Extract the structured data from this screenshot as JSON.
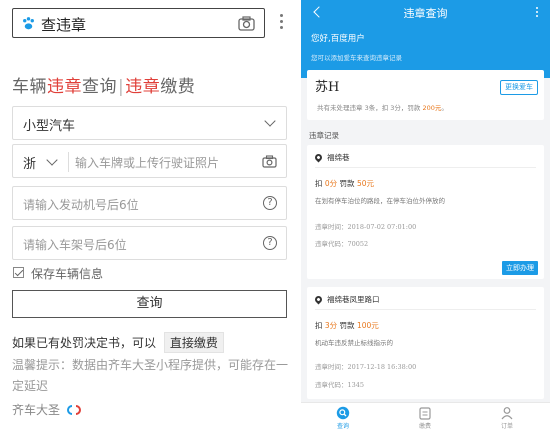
{
  "left": {
    "search": {
      "text": "查违章"
    },
    "heading": {
      "p1": "车辆",
      "p2": "违章",
      "p3": "查询",
      "sep": "|",
      "p4": "违章",
      "p5": "缴费"
    },
    "vehicle_type": "小型汽车",
    "province": "浙",
    "plate_placeholder": "输入车牌或上传行驶证照片",
    "engine_placeholder": "请输入发动机号后6位",
    "frame_placeholder": "请输入车架号后6位",
    "save_label": "保存车辆信息",
    "query_label": "查询",
    "penalty_prompt": "如果已有处罚决定书，可以",
    "direct_pay_label": "直接缴费",
    "tip": "温馨提示：数据由齐车大圣小程序提供，可能存在一定延迟",
    "brand": "齐车大圣"
  },
  "right": {
    "title": "违章查询",
    "greeting": "您好,百度用户",
    "subgreeting": "您可以添加爱车来查询违章记录",
    "plate": "苏H",
    "change_car_label": "更换爱车",
    "summary": {
      "a": "共有未处理违章 3条，扣 3分，罚款 ",
      "money": "200元",
      "b": "。"
    },
    "records_title": "违章记录",
    "records": [
      {
        "location": "福绵巷",
        "points_prefix": "扣 ",
        "points": "0分",
        "fine_prefix": " 罚款 ",
        "fine": "50元",
        "description": "在划有停车泊位的路段，在停车泊位外停放的",
        "time_label": "违章时间：",
        "time": "2018-07-02 07:01:00",
        "code_label": "违章代码：",
        "code": "70052",
        "action": "立即办理"
      },
      {
        "location": "福绵巷凤里路口",
        "points_prefix": "扣 ",
        "points": "3分",
        "fine_prefix": " 罚款 ",
        "fine": "100元",
        "description": "机动车违反禁止标线指示的",
        "time_label": "违章时间：",
        "time": "2017-12-18 16:38:00",
        "code_label": "违章代码：",
        "code": "1345"
      }
    ],
    "tabs": [
      {
        "label": "查询",
        "icon": "search-icon"
      },
      {
        "label": "缴费",
        "icon": "payment-icon"
      },
      {
        "label": "订单",
        "icon": "person-icon"
      }
    ]
  },
  "colors": {
    "accent": "#1c9be6",
    "red": "#e0403a",
    "orange": "#e8781e"
  }
}
